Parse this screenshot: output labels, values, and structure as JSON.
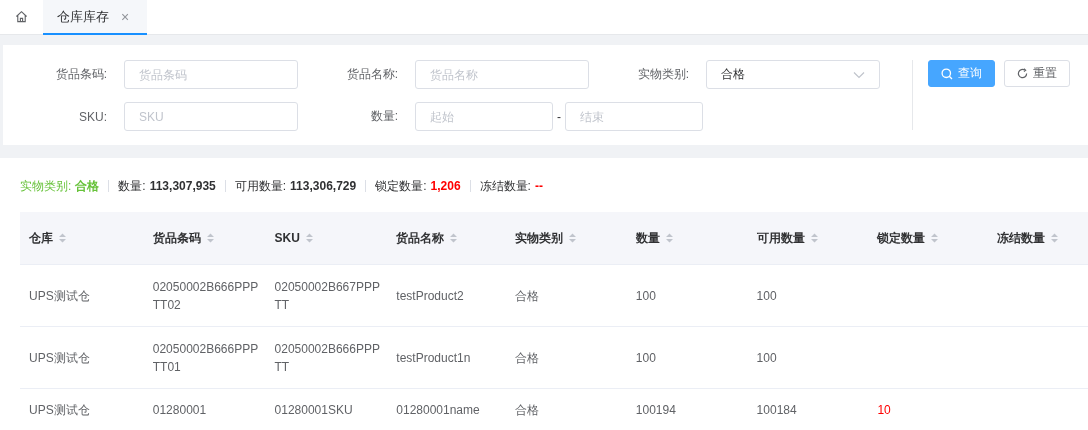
{
  "tabs": [
    {
      "kind": "home",
      "selected": false
    },
    {
      "kind": "page",
      "label": "仓库库存",
      "close": "×",
      "selected": true
    }
  ],
  "filter": {
    "rows": [
      {
        "fields": [
          {
            "kind": "input",
            "label": "货品条码:",
            "placeholder": "货品条码"
          },
          {
            "kind": "input",
            "label": "货品名称:",
            "placeholder": "货品名称"
          },
          {
            "kind": "select",
            "label": "实物类别:",
            "value": "合格"
          }
        ]
      },
      {
        "fields": [
          {
            "kind": "input",
            "label": "SKU:",
            "placeholder": "SKU"
          },
          {
            "kind": "range",
            "label": "数量:",
            "placeholder": "起始",
            "separator": "-",
            "placeholder_end": "结束"
          }
        ]
      }
    ],
    "buttons": [
      {
        "kind": "primary",
        "label": "查询"
      },
      {
        "kind": "default",
        "label": "重置"
      }
    ]
  },
  "summary": [
    {
      "kind": "category",
      "label": "实物类别:",
      "value": "合格",
      "color": "#67c23a"
    },
    {
      "kind": "count",
      "label": "数量:",
      "value": "113,307,935",
      "color": "#303133"
    },
    {
      "kind": "count",
      "label": "可用数量:",
      "value": "113,306,729",
      "color": "#303133"
    },
    {
      "kind": "count",
      "label": "锁定数量:",
      "value": "1,206",
      "color": "#ff0000"
    },
    {
      "kind": "count",
      "label": "冻结数量:",
      "value": "--",
      "color": "#ff0000"
    }
  ],
  "table": {
    "columns": [
      {
        "label": "仓库"
      },
      {
        "label": "货品条码"
      },
      {
        "label": "SKU"
      },
      {
        "label": "货品名称"
      },
      {
        "label": "实物类别"
      },
      {
        "label": "数量"
      },
      {
        "label": "可用数量"
      },
      {
        "label": "锁定数量",
        "kind": "danger"
      },
      {
        "label": "冻结数量"
      }
    ],
    "rows": [
      [
        "UPS测试仓",
        "02050002B666PPPTT02",
        "02050002B667PPPTT",
        "testProduct2",
        "合格",
        "100",
        "100",
        "",
        ""
      ],
      [
        "UPS测试仓",
        "02050002B666PPPTT01",
        "02050002B666PPPTT",
        "testProduct1n",
        "合格",
        "100",
        "100",
        "",
        ""
      ],
      [
        "UPS测试仓",
        "01280001",
        "01280001SKU",
        "01280001name",
        "合格",
        "100194",
        "100184",
        "10",
        ""
      ]
    ]
  }
}
